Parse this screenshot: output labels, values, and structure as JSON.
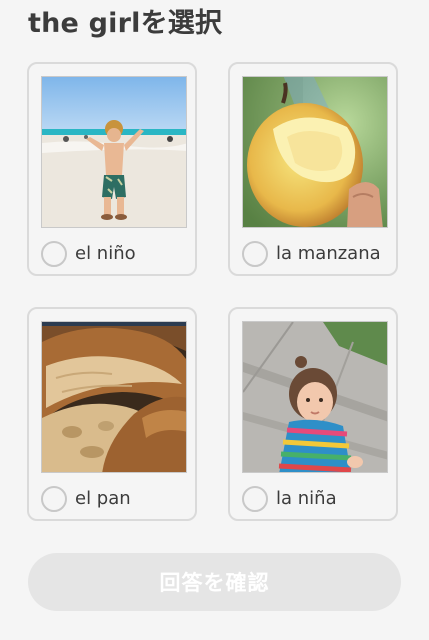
{
  "prompt": "the girlを選択",
  "options": [
    {
      "label": "el niño",
      "image": "boy-on-beach-photo"
    },
    {
      "label": "la manzana",
      "image": "bitten-apple-photo"
    },
    {
      "label": "el pan",
      "image": "bread-loaf-photo"
    },
    {
      "label": "la niña",
      "image": "little-girl-photo"
    }
  ],
  "check_button": {
    "label": "回答を確認",
    "enabled": false
  },
  "colors": {
    "background": "#f5f5f5",
    "card_border": "#dadada",
    "text": "#3c3c3c",
    "button_disabled": "#e5e5e5"
  }
}
